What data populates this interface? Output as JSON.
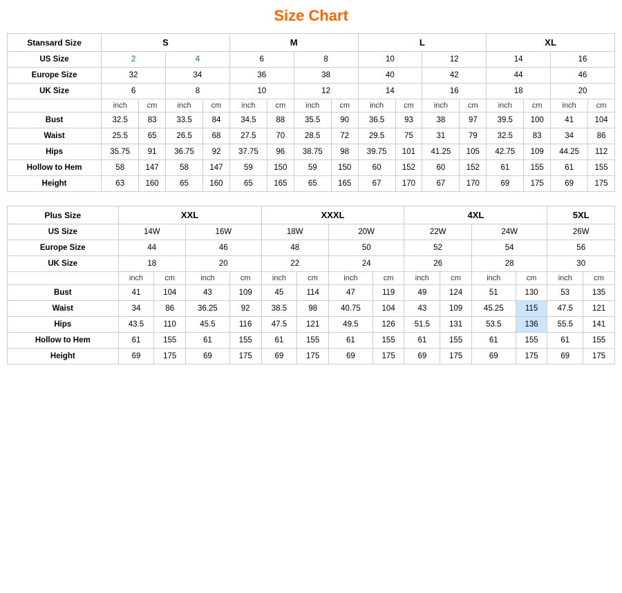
{
  "title": "Size Chart",
  "standard_table": {
    "main_header": "Stansard Size",
    "size_groups": [
      "S",
      "M",
      "L",
      "XL"
    ],
    "rows": {
      "us_size": {
        "label": "US Size",
        "values": [
          "2",
          "4",
          "6",
          "8",
          "10",
          "12",
          "14",
          "16"
        ]
      },
      "europe_size": {
        "label": "Europe Size",
        "values": [
          "32",
          "34",
          "36",
          "38",
          "40",
          "42",
          "44",
          "46"
        ]
      },
      "uk_size": {
        "label": "UK Size",
        "values": [
          "6",
          "8",
          "10",
          "12",
          "14",
          "16",
          "18",
          "20"
        ]
      },
      "units": [
        "inch",
        "cm",
        "inch",
        "cm",
        "inch",
        "cm",
        "inch",
        "cm",
        "inch",
        "cm",
        "inch",
        "cm",
        "inch",
        "cm",
        "inch",
        "cm"
      ],
      "bust": {
        "label": "Bust",
        "values": [
          "32.5",
          "83",
          "33.5",
          "84",
          "34.5",
          "88",
          "35.5",
          "90",
          "36.5",
          "93",
          "38",
          "97",
          "39.5",
          "100",
          "41",
          "104"
        ]
      },
      "waist": {
        "label": "Waist",
        "values": [
          "25.5",
          "65",
          "26.5",
          "68",
          "27.5",
          "70",
          "28.5",
          "72",
          "29.5",
          "75",
          "31",
          "79",
          "32.5",
          "83",
          "34",
          "86"
        ]
      },
      "hips": {
        "label": "Hips",
        "values": [
          "35.75",
          "91",
          "36.75",
          "92",
          "37.75",
          "96",
          "38.75",
          "98",
          "39.75",
          "101",
          "41.25",
          "105",
          "42.75",
          "109",
          "44.25",
          "112"
        ]
      },
      "hollow_to_hem": {
        "label": "Hollow to Hem",
        "values": [
          "58",
          "147",
          "58",
          "147",
          "59",
          "150",
          "59",
          "150",
          "60",
          "152",
          "60",
          "152",
          "61",
          "155",
          "61",
          "155"
        ]
      },
      "height": {
        "label": "Height",
        "values": [
          "63",
          "160",
          "65",
          "160",
          "65",
          "165",
          "65",
          "165",
          "67",
          "170",
          "67",
          "170",
          "69",
          "175",
          "69",
          "175"
        ]
      }
    }
  },
  "plus_table": {
    "main_header": "Plus Size",
    "size_groups": [
      "XXL",
      "XXXL",
      "4XL",
      "5XL"
    ],
    "rows": {
      "us_size": {
        "label": "US Size",
        "values": [
          "14W",
          "16W",
          "18W",
          "20W",
          "22W",
          "24W",
          "26W"
        ]
      },
      "europe_size": {
        "label": "Europe Size",
        "values": [
          "44",
          "46",
          "48",
          "50",
          "52",
          "54",
          "56"
        ]
      },
      "uk_size": {
        "label": "UK Size",
        "values": [
          "18",
          "20",
          "22",
          "24",
          "26",
          "28",
          "30"
        ]
      },
      "units": [
        "inch",
        "cm",
        "inch",
        "cm",
        "inch",
        "cm",
        "inch",
        "cm",
        "inch",
        "cm",
        "inch",
        "cm",
        "inch",
        "cm"
      ],
      "bust": {
        "label": "Bust",
        "values": [
          "41",
          "104",
          "43",
          "109",
          "45",
          "114",
          "47",
          "119",
          "49",
          "124",
          "51",
          "130",
          "53",
          "135"
        ]
      },
      "waist": {
        "label": "Waist",
        "values": [
          "34",
          "86",
          "36.25",
          "92",
          "38.5",
          "98",
          "40.75",
          "104",
          "43",
          "109",
          "45.25",
          "115",
          "47.5",
          "121"
        ]
      },
      "hips": {
        "label": "Hips",
        "values": [
          "43.5",
          "110",
          "45.5",
          "116",
          "47.5",
          "121",
          "49.5",
          "126",
          "51.5",
          "131",
          "53.5",
          "136",
          "55.5",
          "141"
        ]
      },
      "hollow_to_hem": {
        "label": "Hollow to Hem",
        "values": [
          "61",
          "155",
          "61",
          "155",
          "61",
          "155",
          "61",
          "155",
          "61",
          "155",
          "61",
          "155",
          "61",
          "155"
        ]
      },
      "height": {
        "label": "Height",
        "values": [
          "69",
          "175",
          "69",
          "175",
          "69",
          "175",
          "69",
          "175",
          "69",
          "175",
          "69",
          "175",
          "69",
          "175"
        ]
      }
    }
  }
}
